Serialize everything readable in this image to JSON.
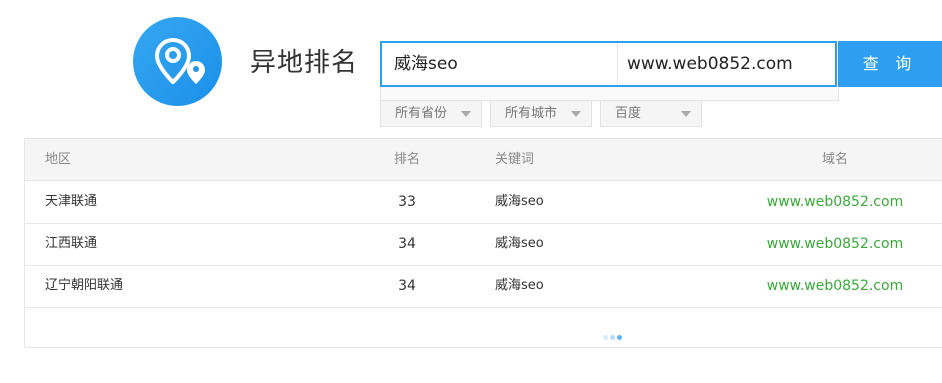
{
  "header": {
    "title": "异地排名"
  },
  "search": {
    "keyword_value": "威海seo",
    "domain_value": "www.web0852.com",
    "button_label": "查 询"
  },
  "filters": [
    {
      "label": "所有省份"
    },
    {
      "label": "所有城市"
    },
    {
      "label": "百度"
    }
  ],
  "table": {
    "columns": [
      "地区",
      "排名",
      "关键词",
      "域名"
    ],
    "rows": [
      {
        "region": "天津联通",
        "rank": "33",
        "keyword": "威海seo",
        "domain": "www.web0852.com"
      },
      {
        "region": "江西联通",
        "rank": "34",
        "keyword": "威海seo",
        "domain": "www.web0852.com"
      },
      {
        "region": "辽宁朝阳联通",
        "rank": "34",
        "keyword": "威海seo",
        "domain": "www.web0852.com"
      }
    ]
  },
  "colors": {
    "accent": "#2d9ef0",
    "domain_link": "#3aa93a",
    "loader_dots": [
      "#d6ecfb",
      "#b3dcf8",
      "#5ab4f3"
    ]
  },
  "icons": {
    "logo": "map-pin-icon"
  }
}
